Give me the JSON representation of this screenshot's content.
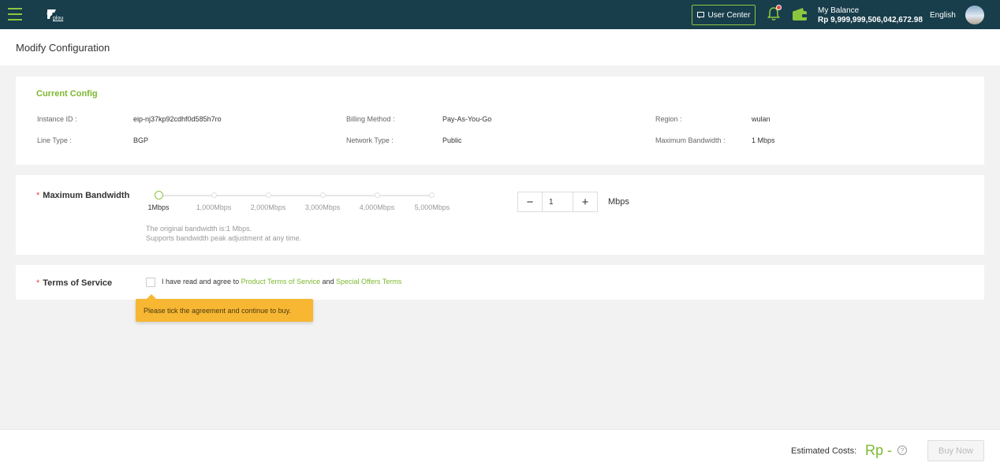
{
  "header": {
    "logo_text": "plou",
    "user_center_label": "User Center",
    "balance_label": "My Balance",
    "balance_value": "Rp 9,999,999,506,042,672.98",
    "language": "English"
  },
  "page": {
    "title": "Modify Configuration"
  },
  "current_config": {
    "title": "Current Config",
    "instance_id_label": "Instance ID :",
    "instance_id_value": "eip-nj37kp92cdhf0d585h7ro",
    "billing_method_label": "Billing Method :",
    "billing_method_value": "Pay-As-You-Go",
    "region_label": "Region :",
    "region_value": "wulan",
    "line_type_label": "Line Type :",
    "line_type_value": "BGP",
    "network_type_label": "Network Type :",
    "network_type_value": "Public",
    "max_bandwidth_label": "Maximum Bandwidth :",
    "max_bandwidth_value": "1 Mbps"
  },
  "bandwidth": {
    "label": "Maximum Bandwidth",
    "ticks": [
      "1Mbps",
      "1,000Mbps",
      "2,000Mbps",
      "3,000Mbps",
      "4,000Mbps",
      "5,000Mbps"
    ],
    "value": "1",
    "unit": "Mbps",
    "minus_symbol": "−",
    "plus_symbol": "+",
    "note_line1": "The original bandwidth is:1 Mbps.",
    "note_line2": "Supports bandwidth peak adjustment at any time."
  },
  "terms": {
    "label": "Terms of Service",
    "prefix": "I have read and agree to",
    "product_terms_link": "Product Terms of Service",
    "and_text": "and",
    "offer_terms_link": "Special Offers Terms",
    "tooltip": "Please tick the agreement and continue to buy."
  },
  "footer": {
    "estimated_label": "Estimated Costs:",
    "estimated_value": "Rp -",
    "help_symbol": "?",
    "buy_label": "Buy Now"
  },
  "colors": {
    "topbar": "#183d4b",
    "accent": "#8cc63f",
    "link": "#7cb82f",
    "required": "#e84646",
    "tooltip": "#f7b733"
  }
}
